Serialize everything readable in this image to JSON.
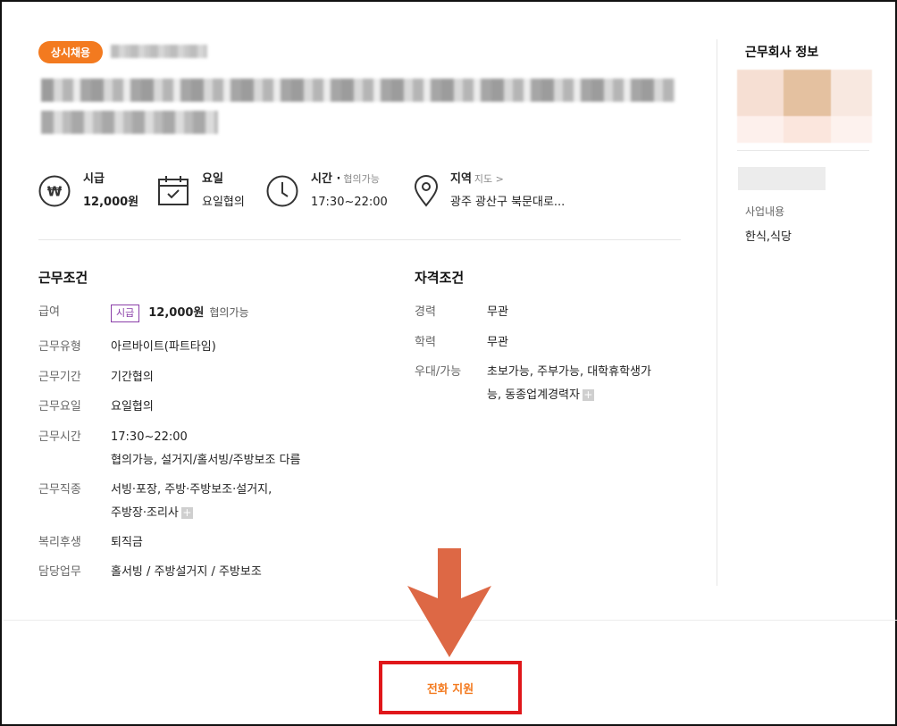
{
  "header": {
    "badge": "상시채용"
  },
  "summary": {
    "wage": {
      "label": "시급",
      "value": "12,000원"
    },
    "days": {
      "label": "요일",
      "value": "요일협의"
    },
    "time": {
      "label": "시간 ·",
      "sub": "협의가능",
      "value": "17:30~22:00"
    },
    "region": {
      "label": "지역",
      "sub": "지도 >",
      "value": "광주 광산구 북문대로..."
    }
  },
  "conditions": {
    "title": "근무조건",
    "wage": {
      "key": "급여",
      "tag": "시급",
      "amount": "12,000원",
      "note": "협의가능"
    },
    "type": {
      "key": "근무유형",
      "value": "아르바이트(파트타임)"
    },
    "period": {
      "key": "근무기간",
      "value": "기간협의"
    },
    "days": {
      "key": "근무요일",
      "value": "요일협의"
    },
    "hours": {
      "key": "근무시간",
      "value": "17:30~22:00",
      "detail": "협의가능, 설거지/홀서빙/주방보조 다름"
    },
    "job": {
      "key": "근무직종",
      "line1": "서빙·포장, 주방·주방보조·설거지,",
      "line2": "주방장·조리사"
    },
    "welfare": {
      "key": "복리후생",
      "value": "퇴직금"
    },
    "duty": {
      "key": "담당업무",
      "value": "홀서빙 / 주방설거지 / 주방보조"
    }
  },
  "qualifications": {
    "title": "자격조건",
    "career": {
      "key": "경력",
      "value": "무관"
    },
    "education": {
      "key": "학력",
      "value": "무관"
    },
    "preference": {
      "key": "우대/가능",
      "line1": "초보가능, 주부가능, 대학휴학생가",
      "line2": "능, 동종업계경력자"
    }
  },
  "company": {
    "title": "근무회사 정보",
    "business_label": "사업내용",
    "business_value": "한식,식당"
  },
  "cta": {
    "label": "전화 지원"
  },
  "colors": {
    "accent": "#f37a1f",
    "highlight_border": "#e0171a",
    "arrow": "#dd6845",
    "tag": "#8a3ea8"
  }
}
